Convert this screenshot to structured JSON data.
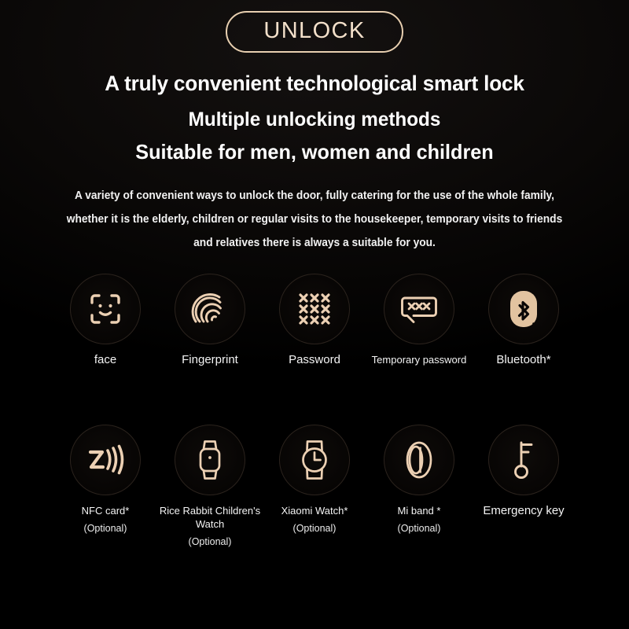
{
  "badge": {
    "label": "UNLOCK"
  },
  "headings": {
    "main": "A truly convenient technological smart lock",
    "sub": "Multiple unlocking methods",
    "sub2": "Suitable for men, women and children"
  },
  "body": {
    "line1": "A variety of convenient ways to unlock the door, fully catering for the use of the whole family,",
    "line2": "whether it is the elderly, children or regular visits to the housekeeper, temporary visits to friends",
    "line3": "and relatives there is always a suitable for you."
  },
  "colors": {
    "background": "#000000",
    "accent_gold": "#e8cfb0",
    "icon_cream": "#ecd0b3",
    "text_white": "#ffffff",
    "circle_outline": "#2b231d"
  },
  "methods": {
    "row1": [
      {
        "icon": "face-id-icon",
        "label": "face",
        "optional": ""
      },
      {
        "icon": "fingerprint-icon",
        "label": "Fingerprint",
        "optional": ""
      },
      {
        "icon": "password-grid-icon",
        "label": "Password",
        "optional": ""
      },
      {
        "icon": "temporary-password-icon",
        "label": "Temporary password",
        "optional": ""
      },
      {
        "icon": "bluetooth-icon",
        "label": "Bluetooth*",
        "optional": ""
      }
    ],
    "row2": [
      {
        "icon": "nfc-icon",
        "label": "NFC card*",
        "optional": "(Optional)"
      },
      {
        "icon": "childrens-watch-icon",
        "label": "Rice Rabbit Children's Watch",
        "optional": "(Optional)"
      },
      {
        "icon": "xiaomi-watch-icon",
        "label": "Xiaomi Watch*",
        "optional": "(Optional)"
      },
      {
        "icon": "mi-band-icon",
        "label": "Mi band *",
        "optional": "(Optional)"
      },
      {
        "icon": "emergency-key-icon",
        "label": "Emergency key",
        "optional": ""
      }
    ]
  }
}
